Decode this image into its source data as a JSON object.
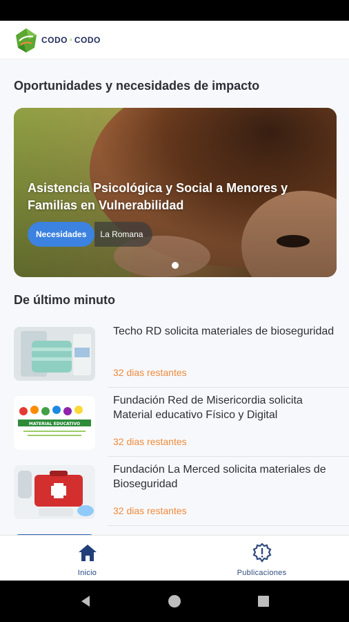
{
  "header": {
    "brand_left": "CODO",
    "brand_mid": "a",
    "brand_right": "CODO"
  },
  "sections": {
    "opportunities_title": "Oportunidades y necesidades de impacto",
    "latest_title": "De último minuto"
  },
  "hero": {
    "title": "Asistencia Psicológica y Social a Menores y Familias en Vulnerabilidad",
    "chip_category": "Necesidades",
    "chip_location": "La Romana",
    "carousel_active_index": 0,
    "carousel_count": 1
  },
  "news": [
    {
      "title": "Techo RD solicita materiales de bioseguridad",
      "remaining": "32 dias restantes",
      "thumb_icon": "masks-photo"
    },
    {
      "title": "Fundación Red de Misericordia solicita Material educativo Físico y Digital",
      "remaining": "32 dias restantes",
      "thumb_icon": "educational-material-photo",
      "thumb_caption": "MATERIAL EDUCATIVO"
    },
    {
      "title": "Fundación La Merced solicita materiales de Bioseguridad",
      "remaining": "32 dias restantes",
      "thumb_icon": "first-aid-kit-photo"
    }
  ],
  "bottom_nav": {
    "home_label": "Inicio",
    "posts_label": "Publicaciones",
    "active": "Inicio"
  },
  "colors": {
    "accent_blue": "#3c82e0",
    "nav_blue": "#1f3f7a",
    "deadline_orange": "#ef8a3a",
    "brand_green": "#5aa832"
  }
}
